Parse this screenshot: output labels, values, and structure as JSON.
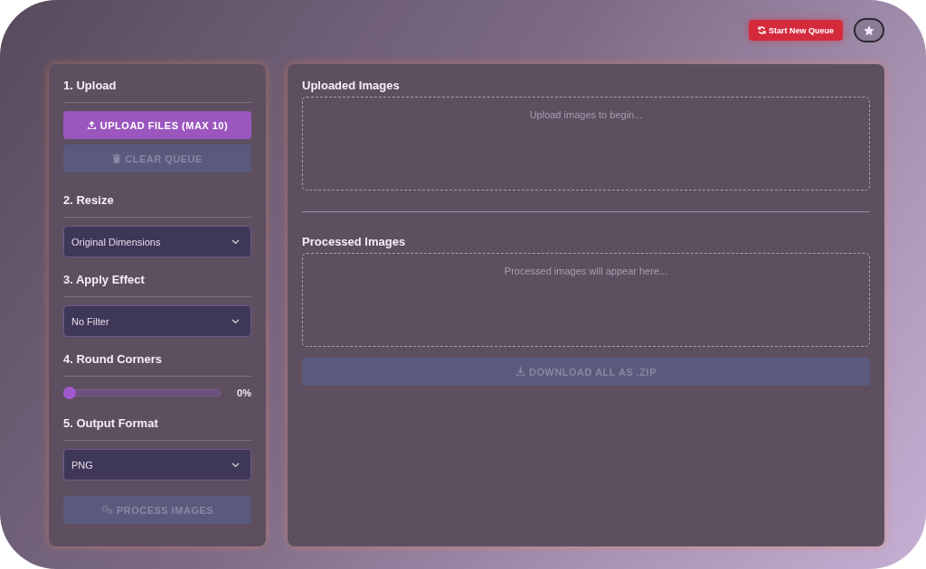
{
  "header": {
    "new_queue_button": {
      "label": "Start New Queue",
      "disabled": false
    }
  },
  "sidebar": {
    "sections": [
      {
        "title": "1. Upload",
        "kind": "buttons",
        "buttons": [
          {
            "label": "UPLOAD FILES (MAX 10)",
            "disabled": false
          },
          {
            "label": "CLEAR QUEUE",
            "disabled": true
          }
        ]
      },
      {
        "title": "2. Resize",
        "kind": "select",
        "value": "Original Dimensions"
      },
      {
        "title": "3. Apply Effect",
        "kind": "select",
        "value": "No Filter"
      },
      {
        "title": "4. Round Corners",
        "kind": "slider",
        "level": 0,
        "reading": "0%"
      },
      {
        "title": "5. Output Format",
        "kind": "select",
        "value": "PNG"
      }
    ],
    "process_button": {
      "label": "PROCESS IMAGES",
      "disabled": true
    }
  },
  "main": {
    "uploaded": {
      "title": "Uploaded Images",
      "placeholder": "Upload images to begin..."
    },
    "processed": {
      "title": "Processed Images",
      "placeholder": "Processed images will appear here..."
    },
    "download_button": {
      "label": "DOWNLOAD ALL AS .ZIP",
      "disabled": true
    }
  }
}
